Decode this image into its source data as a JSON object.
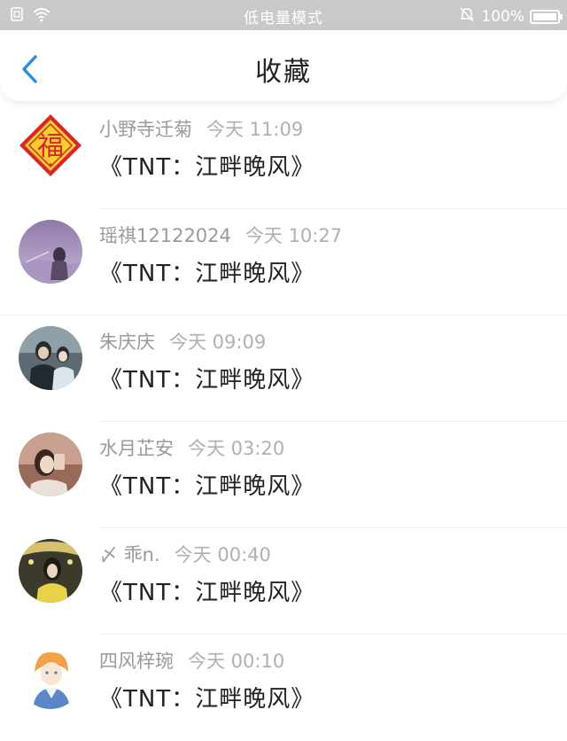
{
  "status_bar": {
    "mode_text": "低电量模式",
    "battery_text": "100%",
    "battery_level": 1.0
  },
  "header": {
    "title": "收藏"
  },
  "items": [
    {
      "username": "小野寺迁菊",
      "time": "今天 11:09",
      "work": "《TNT：江畔晚风》"
    },
    {
      "username": "瑶祺12122024",
      "time": "今天 10:27",
      "work": "《TNT：江畔晚风》"
    },
    {
      "username": "朱庆庆",
      "time": "今天 09:09",
      "work": "《TNT：江畔晚风》"
    },
    {
      "username": "水月芷安",
      "time": "今天 03:20",
      "work": "《TNT：江畔晚风》"
    },
    {
      "username": "〆 乖n.",
      "time": "今天 00:40",
      "work": "《TNT：江畔晚风》"
    },
    {
      "username": "四风梓琬",
      "time": "今天 00:10",
      "work": "《TNT：江畔晚风》"
    }
  ],
  "fu_logo_text": "福",
  "colors": {
    "accent": "#2a8be0",
    "status_bar_bg": "#c9c9c9",
    "fu_red": "#d8262a",
    "fu_gold": "#f5cf2e"
  }
}
